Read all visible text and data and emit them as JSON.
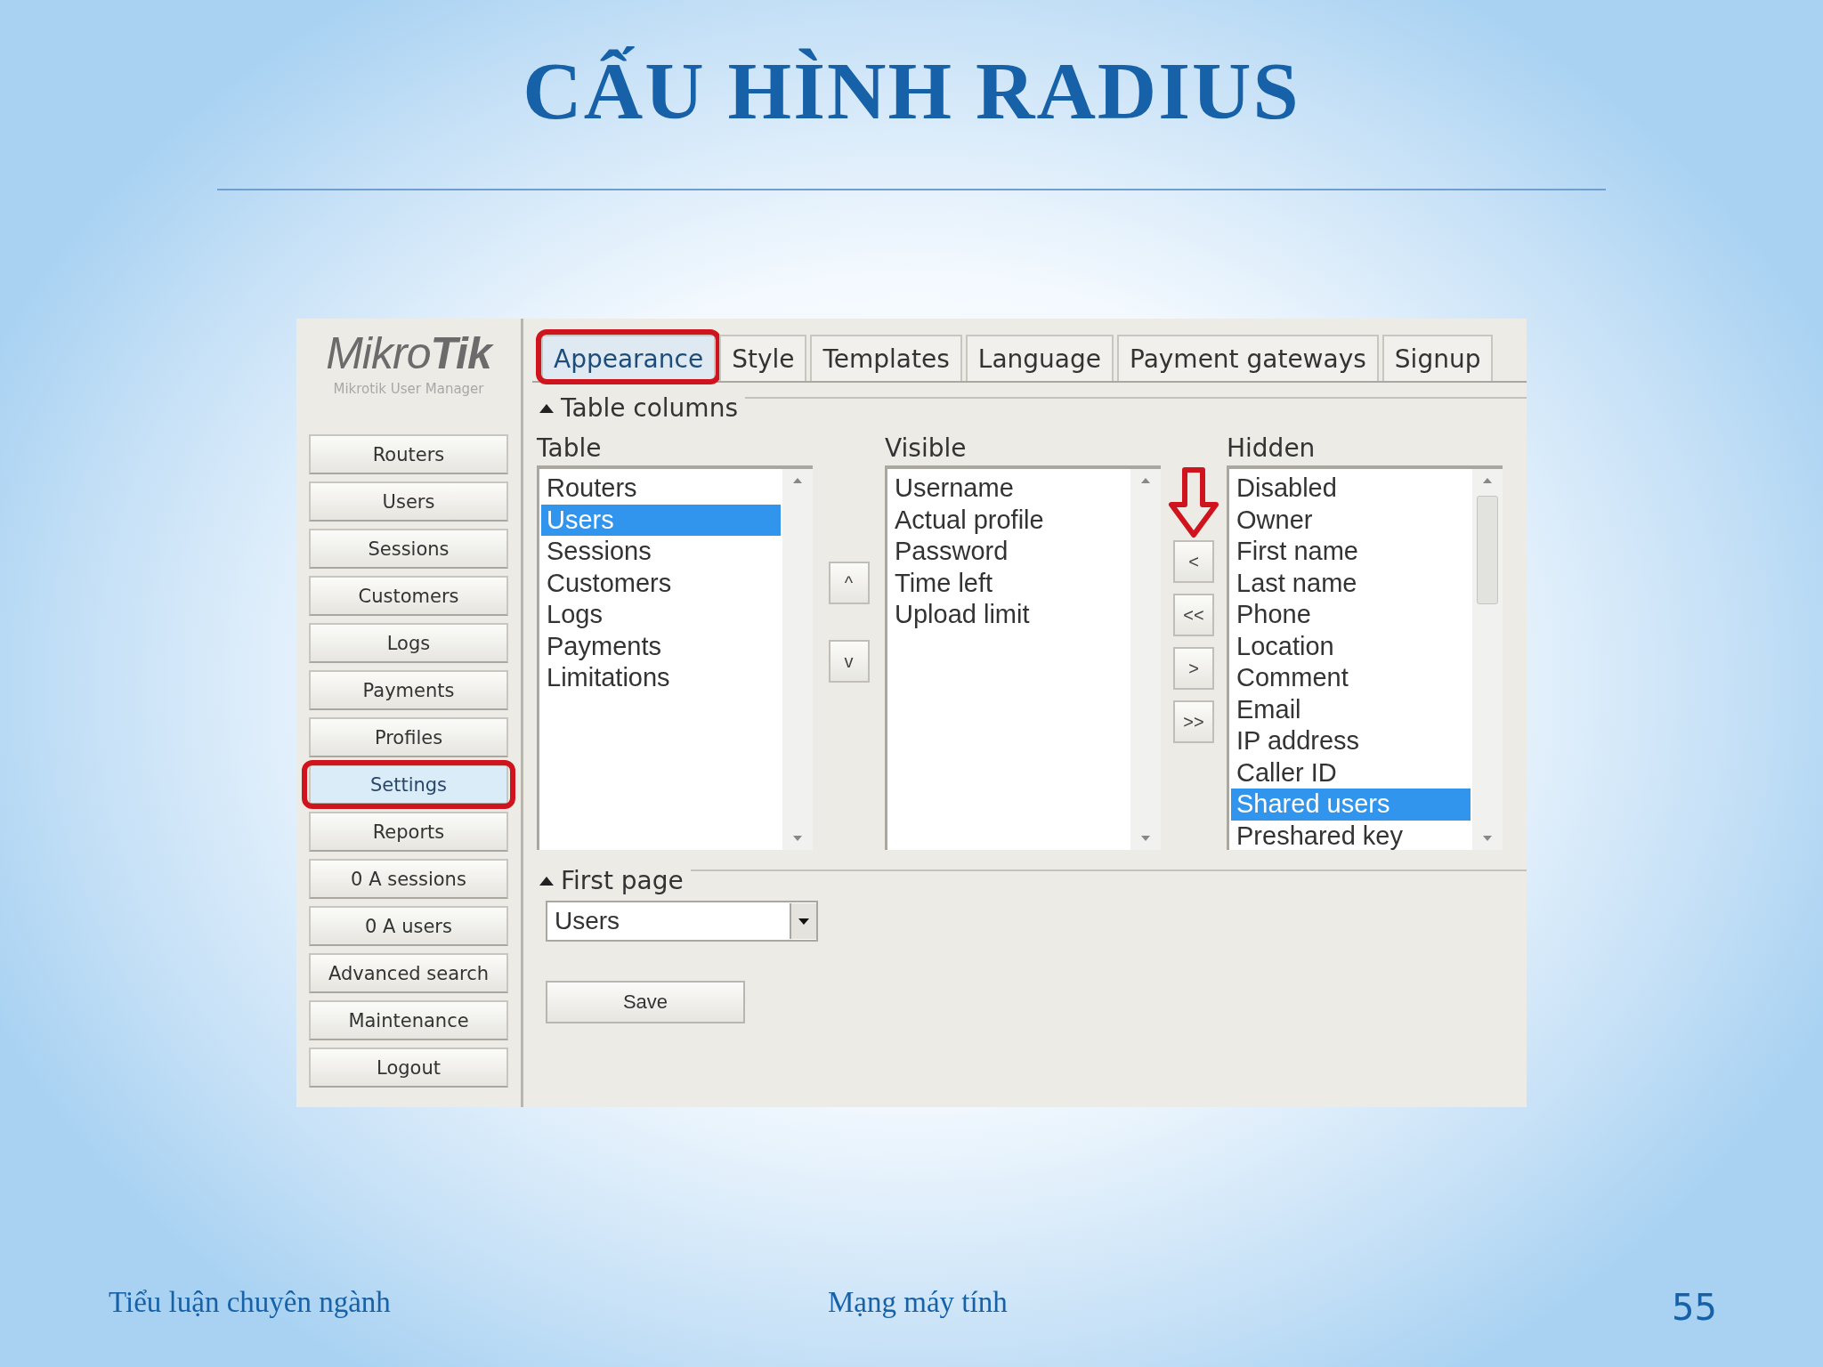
{
  "slide": {
    "title": "CẤU HÌNH RADIUS",
    "footer_left": "Tiểu luận chuyên ngành",
    "footer_center": "Mạng máy tính",
    "page_number": "55"
  },
  "app": {
    "logo": "Mikro**Tik**",
    "logo_subtitle": "Mikrotik User Manager",
    "sidebar": [
      {
        "label": "Routers",
        "selected": false,
        "annotated": false
      },
      {
        "label": "Users",
        "selected": false,
        "annotated": false
      },
      {
        "label": "Sessions",
        "selected": false,
        "annotated": false
      },
      {
        "label": "Customers",
        "selected": false,
        "annotated": false
      },
      {
        "label": "Logs",
        "selected": false,
        "annotated": false
      },
      {
        "label": "Payments",
        "selected": false,
        "annotated": false
      },
      {
        "label": "Profiles",
        "selected": false,
        "annotated": false
      },
      {
        "label": "Settings",
        "selected": true,
        "annotated": true
      },
      {
        "label": "Reports",
        "selected": false,
        "annotated": false
      },
      {
        "label": "0 A sessions",
        "selected": false,
        "annotated": false
      },
      {
        "label": "0 A users",
        "selected": false,
        "annotated": false
      },
      {
        "label": "Advanced search",
        "selected": false,
        "annotated": false
      },
      {
        "label": "Maintenance",
        "selected": false,
        "annotated": false
      },
      {
        "label": "Logout",
        "selected": false,
        "annotated": false
      }
    ],
    "tabs": [
      {
        "label": "Appearance",
        "selected": true,
        "annotated": true
      },
      {
        "label": "Style",
        "selected": false,
        "annotated": false
      },
      {
        "label": "Templates",
        "selected": false,
        "annotated": false
      },
      {
        "label": "Language",
        "selected": false,
        "annotated": false
      },
      {
        "label": "Payment gateways",
        "selected": false,
        "annotated": false
      },
      {
        "label": "Signup",
        "selected": false,
        "annotated": false
      }
    ],
    "table_columns": {
      "heading": "Table columns",
      "table": {
        "label": "Table",
        "items": [
          {
            "label": "Routers",
            "selected": false
          },
          {
            "label": "Users",
            "selected": true
          },
          {
            "label": "Sessions",
            "selected": false
          },
          {
            "label": "Customers",
            "selected": false
          },
          {
            "label": "Logs",
            "selected": false
          },
          {
            "label": "Payments",
            "selected": false
          },
          {
            "label": "Limitations",
            "selected": false
          }
        ]
      },
      "order_buttons": [
        {
          "label": "^"
        },
        {
          "label": "v"
        }
      ],
      "visible": {
        "label": "Visible",
        "items": [
          {
            "label": "Username",
            "selected": false
          },
          {
            "label": "Actual profile",
            "selected": false
          },
          {
            "label": "Password",
            "selected": false
          },
          {
            "label": "Time left",
            "selected": false
          },
          {
            "label": "Upload limit",
            "selected": false
          }
        ]
      },
      "move_buttons": [
        {
          "label": "<",
          "annotated": true
        },
        {
          "label": "<<",
          "annotated": false
        },
        {
          "label": ">",
          "annotated": false
        },
        {
          "label": ">>",
          "annotated": false
        }
      ],
      "hidden": {
        "label": "Hidden",
        "items": [
          {
            "label": "Disabled",
            "selected": false
          },
          {
            "label": "Owner",
            "selected": false
          },
          {
            "label": "First name",
            "selected": false
          },
          {
            "label": "Last name",
            "selected": false
          },
          {
            "label": "Phone",
            "selected": false
          },
          {
            "label": "Location",
            "selected": false
          },
          {
            "label": "Comment",
            "selected": false
          },
          {
            "label": "Email",
            "selected": false
          },
          {
            "label": "IP address",
            "selected": false
          },
          {
            "label": "Caller ID",
            "selected": false
          },
          {
            "label": "Shared users",
            "selected": true
          },
          {
            "label": "Preshared key",
            "selected": false
          }
        ]
      }
    },
    "first_page": {
      "heading": "First page",
      "value": "Users"
    },
    "save_button": "Save"
  }
}
